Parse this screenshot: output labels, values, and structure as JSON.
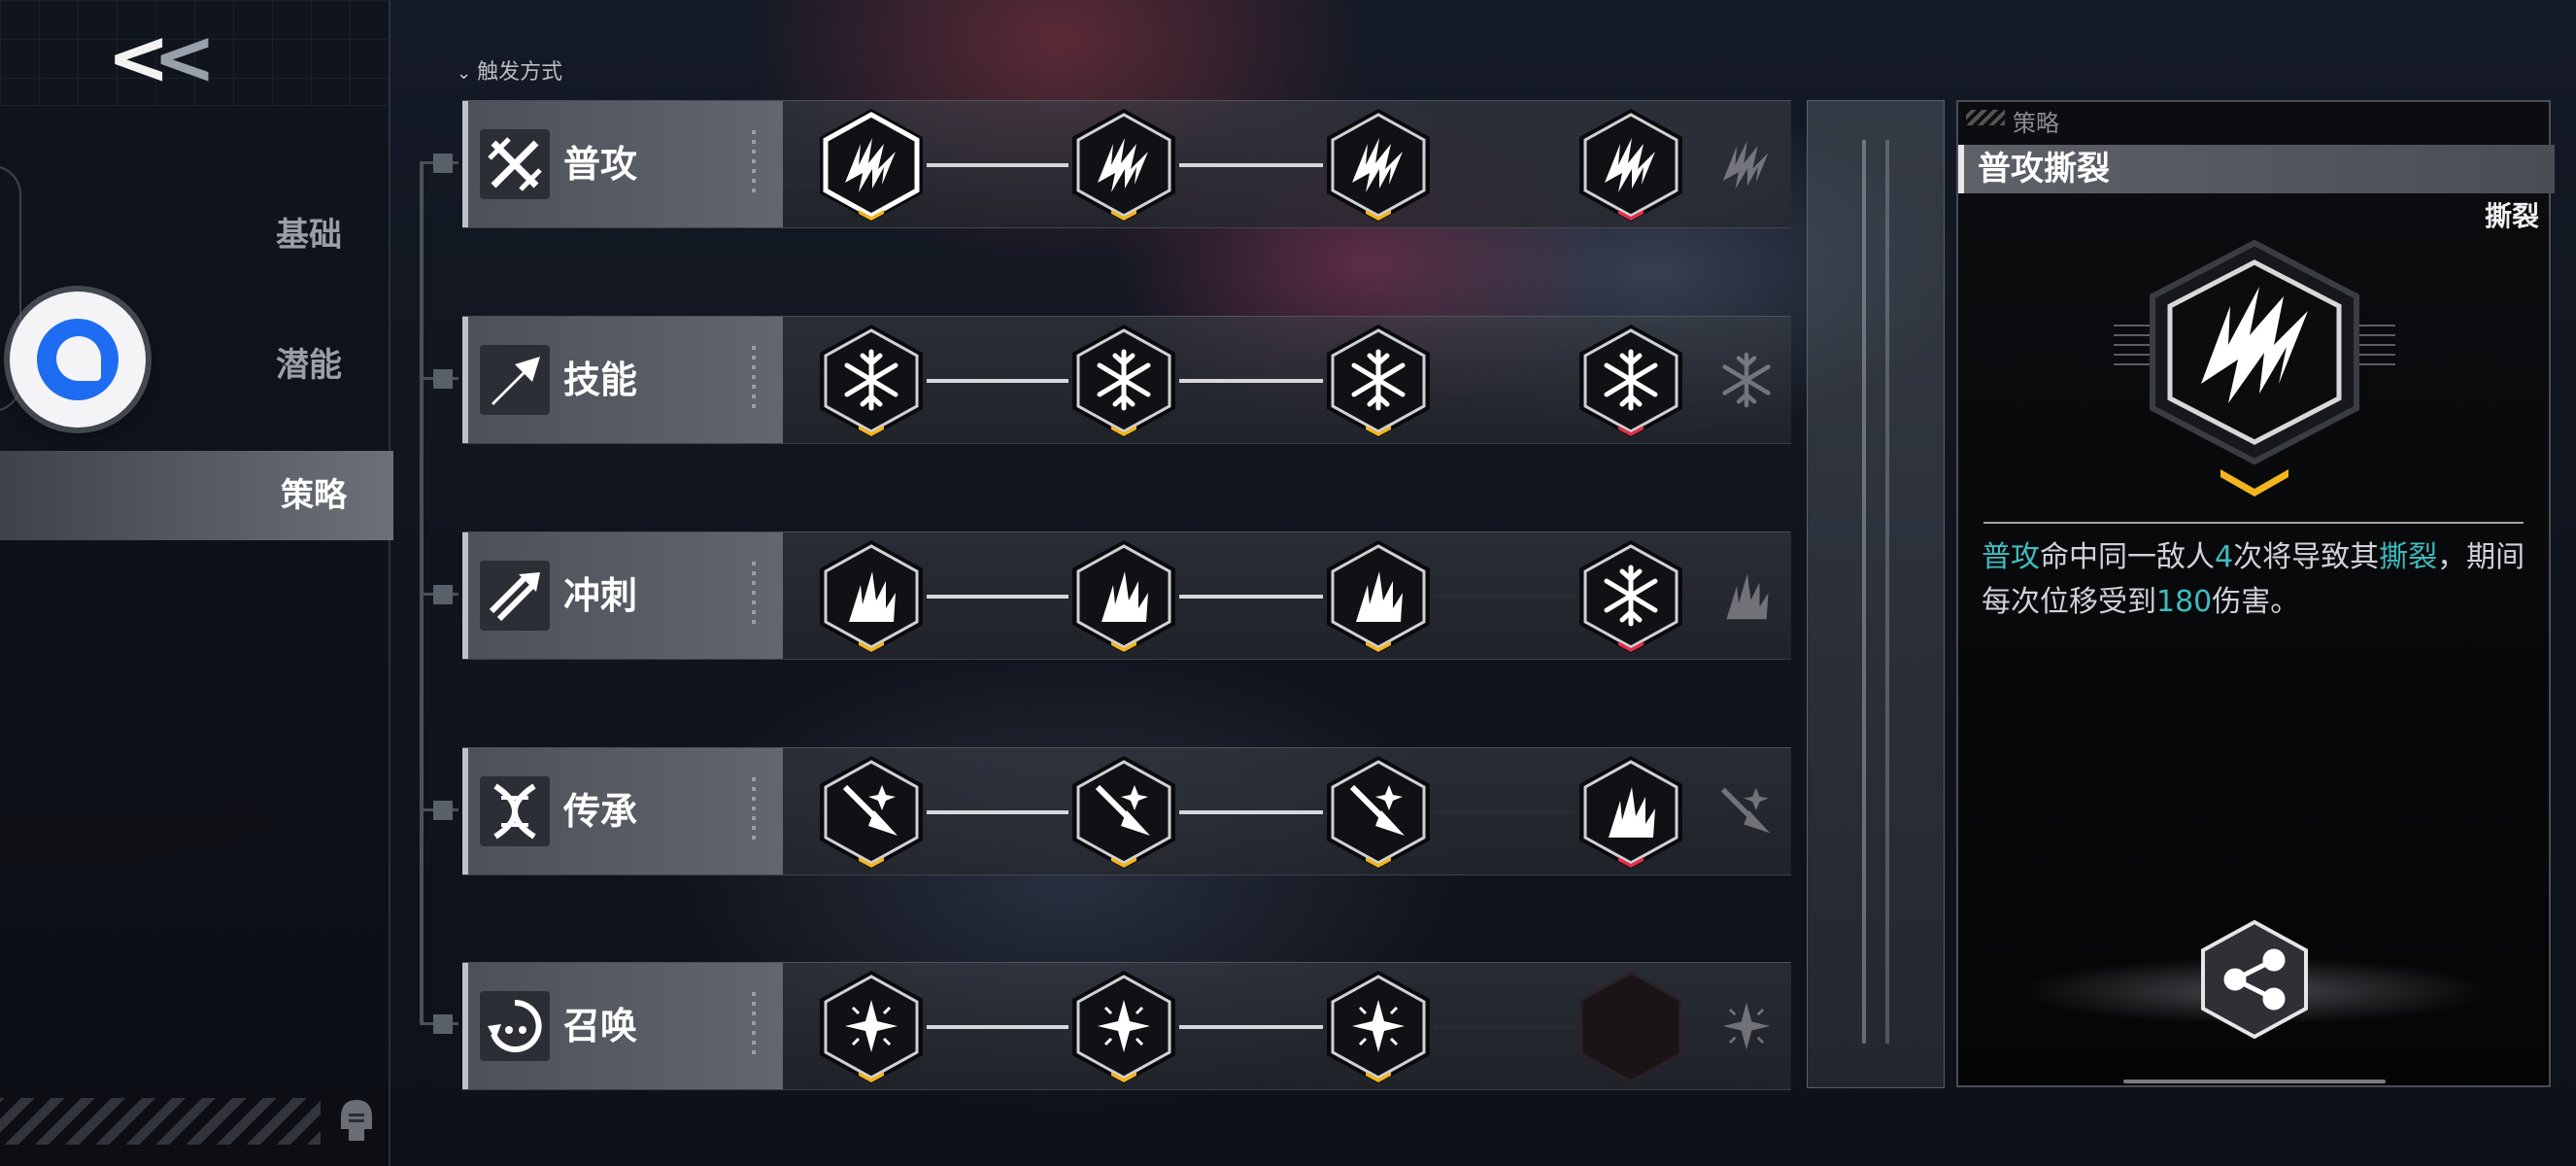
{
  "nav": {
    "back_label": "<<",
    "items": [
      {
        "label": "基础",
        "active": false
      },
      {
        "label": "潜能",
        "active": false
      },
      {
        "label": "策略",
        "active": true
      }
    ]
  },
  "trigger_header": "触发方式",
  "rows": [
    {
      "label": "普攻",
      "icon": "sword-cross-icon",
      "nodes": [
        "claw-slash-icon",
        "claw-slash-drop-icon",
        "claw-slash-skull-icon",
        "claw-slash-spark-icon"
      ],
      "marks": [
        "yellow",
        "yellow",
        "yellow",
        "red"
      ]
    },
    {
      "label": "技能",
      "icon": "arrow-burst-icon",
      "nodes": [
        "snowflake-icon",
        "snowflake-burst-icon",
        "snowflake-core-icon",
        "snowflake-arrow-icon"
      ],
      "marks": [
        "yellow",
        "yellow",
        "yellow",
        "red"
      ]
    },
    {
      "label": "冲刺",
      "icon": "dash-arrow-icon",
      "nodes": [
        "flame-spike-icon",
        "flame-spike-up-icon",
        "flame-spike-cross-icon",
        "snowflake-flame-icon"
      ],
      "marks": [
        "yellow",
        "yellow",
        "yellow",
        "red"
      ]
    },
    {
      "label": "传承",
      "icon": "dna-helix-icon",
      "nodes": [
        "spear-spark-icon",
        "spear-up-icon",
        "spear-star-icon",
        "flame-leaf-icon"
      ],
      "marks": [
        "yellow",
        "yellow",
        "yellow",
        "red"
      ]
    },
    {
      "label": "召唤",
      "icon": "cycle-summon-icon",
      "nodes": [
        "star-burst-icon",
        "star-burst-plus-icon",
        "star-burst-up-icon",
        "empty-slot"
      ],
      "marks": [
        "yellow",
        "yellow",
        "yellow",
        "none"
      ]
    }
  ],
  "detail": {
    "section": "策略",
    "title": "普攻撕裂",
    "tag": "撕裂",
    "desc_parts": [
      {
        "text": "普攻",
        "hl": true
      },
      {
        "text": "命中同一敌人",
        "hl": false
      },
      {
        "text": "4",
        "hl": true
      },
      {
        "text": "次将导致其",
        "hl": false
      },
      {
        "text": "撕裂",
        "hl": true
      },
      {
        "text": "，期间每次位移受到",
        "hl": false
      },
      {
        "text": "180",
        "hl": true
      },
      {
        "text": "伤害。",
        "hl": false
      }
    ]
  },
  "colors": {
    "accent_teal": "#3dbdbf",
    "mark_yellow": "#f2b51c",
    "mark_red": "#e0304a",
    "active_nav": "#6c7078"
  }
}
